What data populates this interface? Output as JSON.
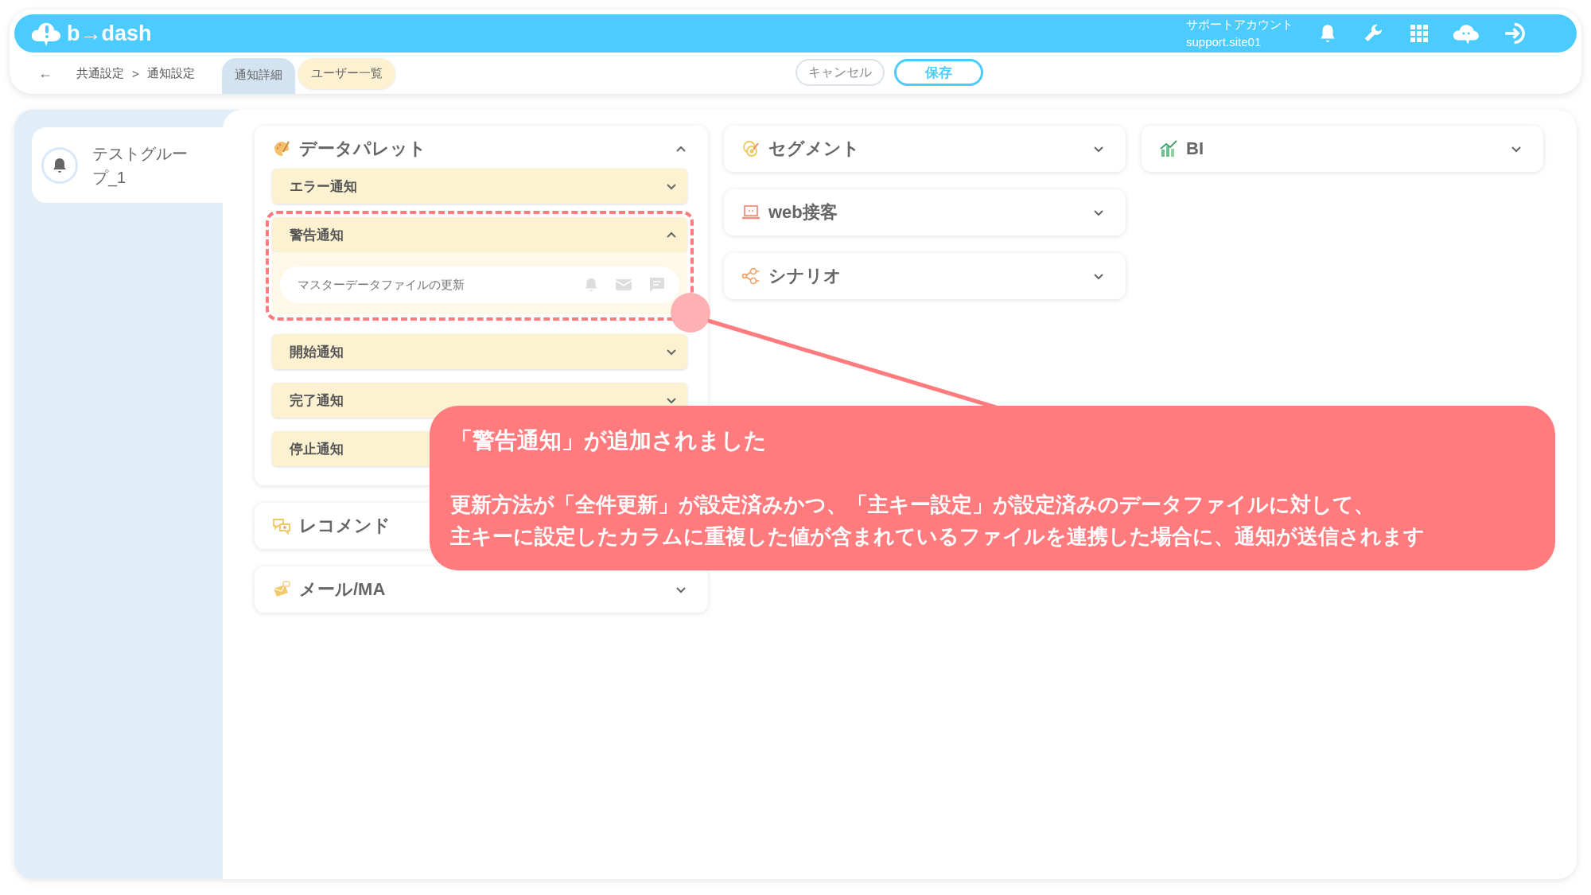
{
  "header": {
    "logo": "b→dash",
    "account_label": "サポートアカウント",
    "account_id": "support.site01"
  },
  "nav": {
    "back": "←",
    "breadcrumb": [
      "共通設定",
      ">",
      "通知設定"
    ],
    "tabs": [
      {
        "label": "通知詳細",
        "selected": true
      },
      {
        "label": "ユーザー一覧",
        "selected": false
      }
    ],
    "cancel": "キャンセル",
    "save": "保存"
  },
  "sidebar": {
    "items": [
      {
        "label": "テストグループ_1",
        "selected": true
      }
    ]
  },
  "columns": [
    [
      {
        "title": "データパレット",
        "expanded": true,
        "groups": [
          {
            "label": "エラー通知",
            "expanded": false,
            "highlighted": false
          },
          {
            "label": "警告通知",
            "expanded": true,
            "highlighted": true,
            "items": [
              "マスターデータファイルの更新"
            ]
          },
          {
            "label": "開始通知",
            "expanded": false,
            "highlighted": false
          },
          {
            "label": "完了通知",
            "expanded": false,
            "highlighted": false
          },
          {
            "label": "停止通知",
            "highlighted": false
          }
        ]
      },
      {
        "title": "レコメンド"
      },
      {
        "title": "メール/MA",
        "expanded": false
      }
    ],
    [
      {
        "title": "セグメント",
        "expanded": false
      },
      {
        "title": "web接客",
        "expanded": false
      },
      {
        "title": "シナリオ",
        "expanded": false
      }
    ],
    [
      {
        "title": "BI",
        "expanded": false
      }
    ]
  ],
  "callout": {
    "title": "「警告通知」が追加されました",
    "lines": [
      "更新方法が「全件更新」が設定済みかつ、「主キー設定」が設定済みのデータファイルに対して、",
      "主キーに設定したカラムに重複した値が含まれているファイルを連携した場合に、通知が送信されます"
    ]
  }
}
